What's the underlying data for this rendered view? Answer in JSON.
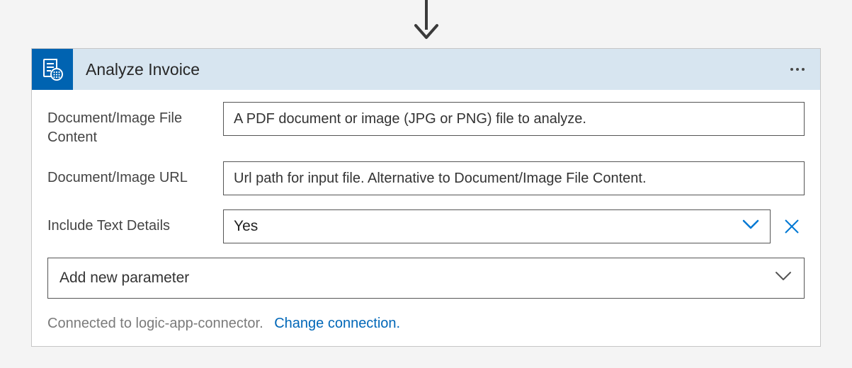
{
  "header": {
    "title": "Analyze Invoice"
  },
  "fields": {
    "file_content": {
      "label": "Document/Image File Content",
      "placeholder": "A PDF document or image (JPG or PNG) file to analyze."
    },
    "url": {
      "label": "Document/Image URL",
      "placeholder": "Url path for input file. Alternative to Document/Image File Content."
    },
    "include_text": {
      "label": "Include Text Details",
      "value": "Yes"
    }
  },
  "add_param": {
    "label": "Add new parameter"
  },
  "footer": {
    "status": "Connected to logic-app-connector.",
    "link": "Change connection."
  }
}
